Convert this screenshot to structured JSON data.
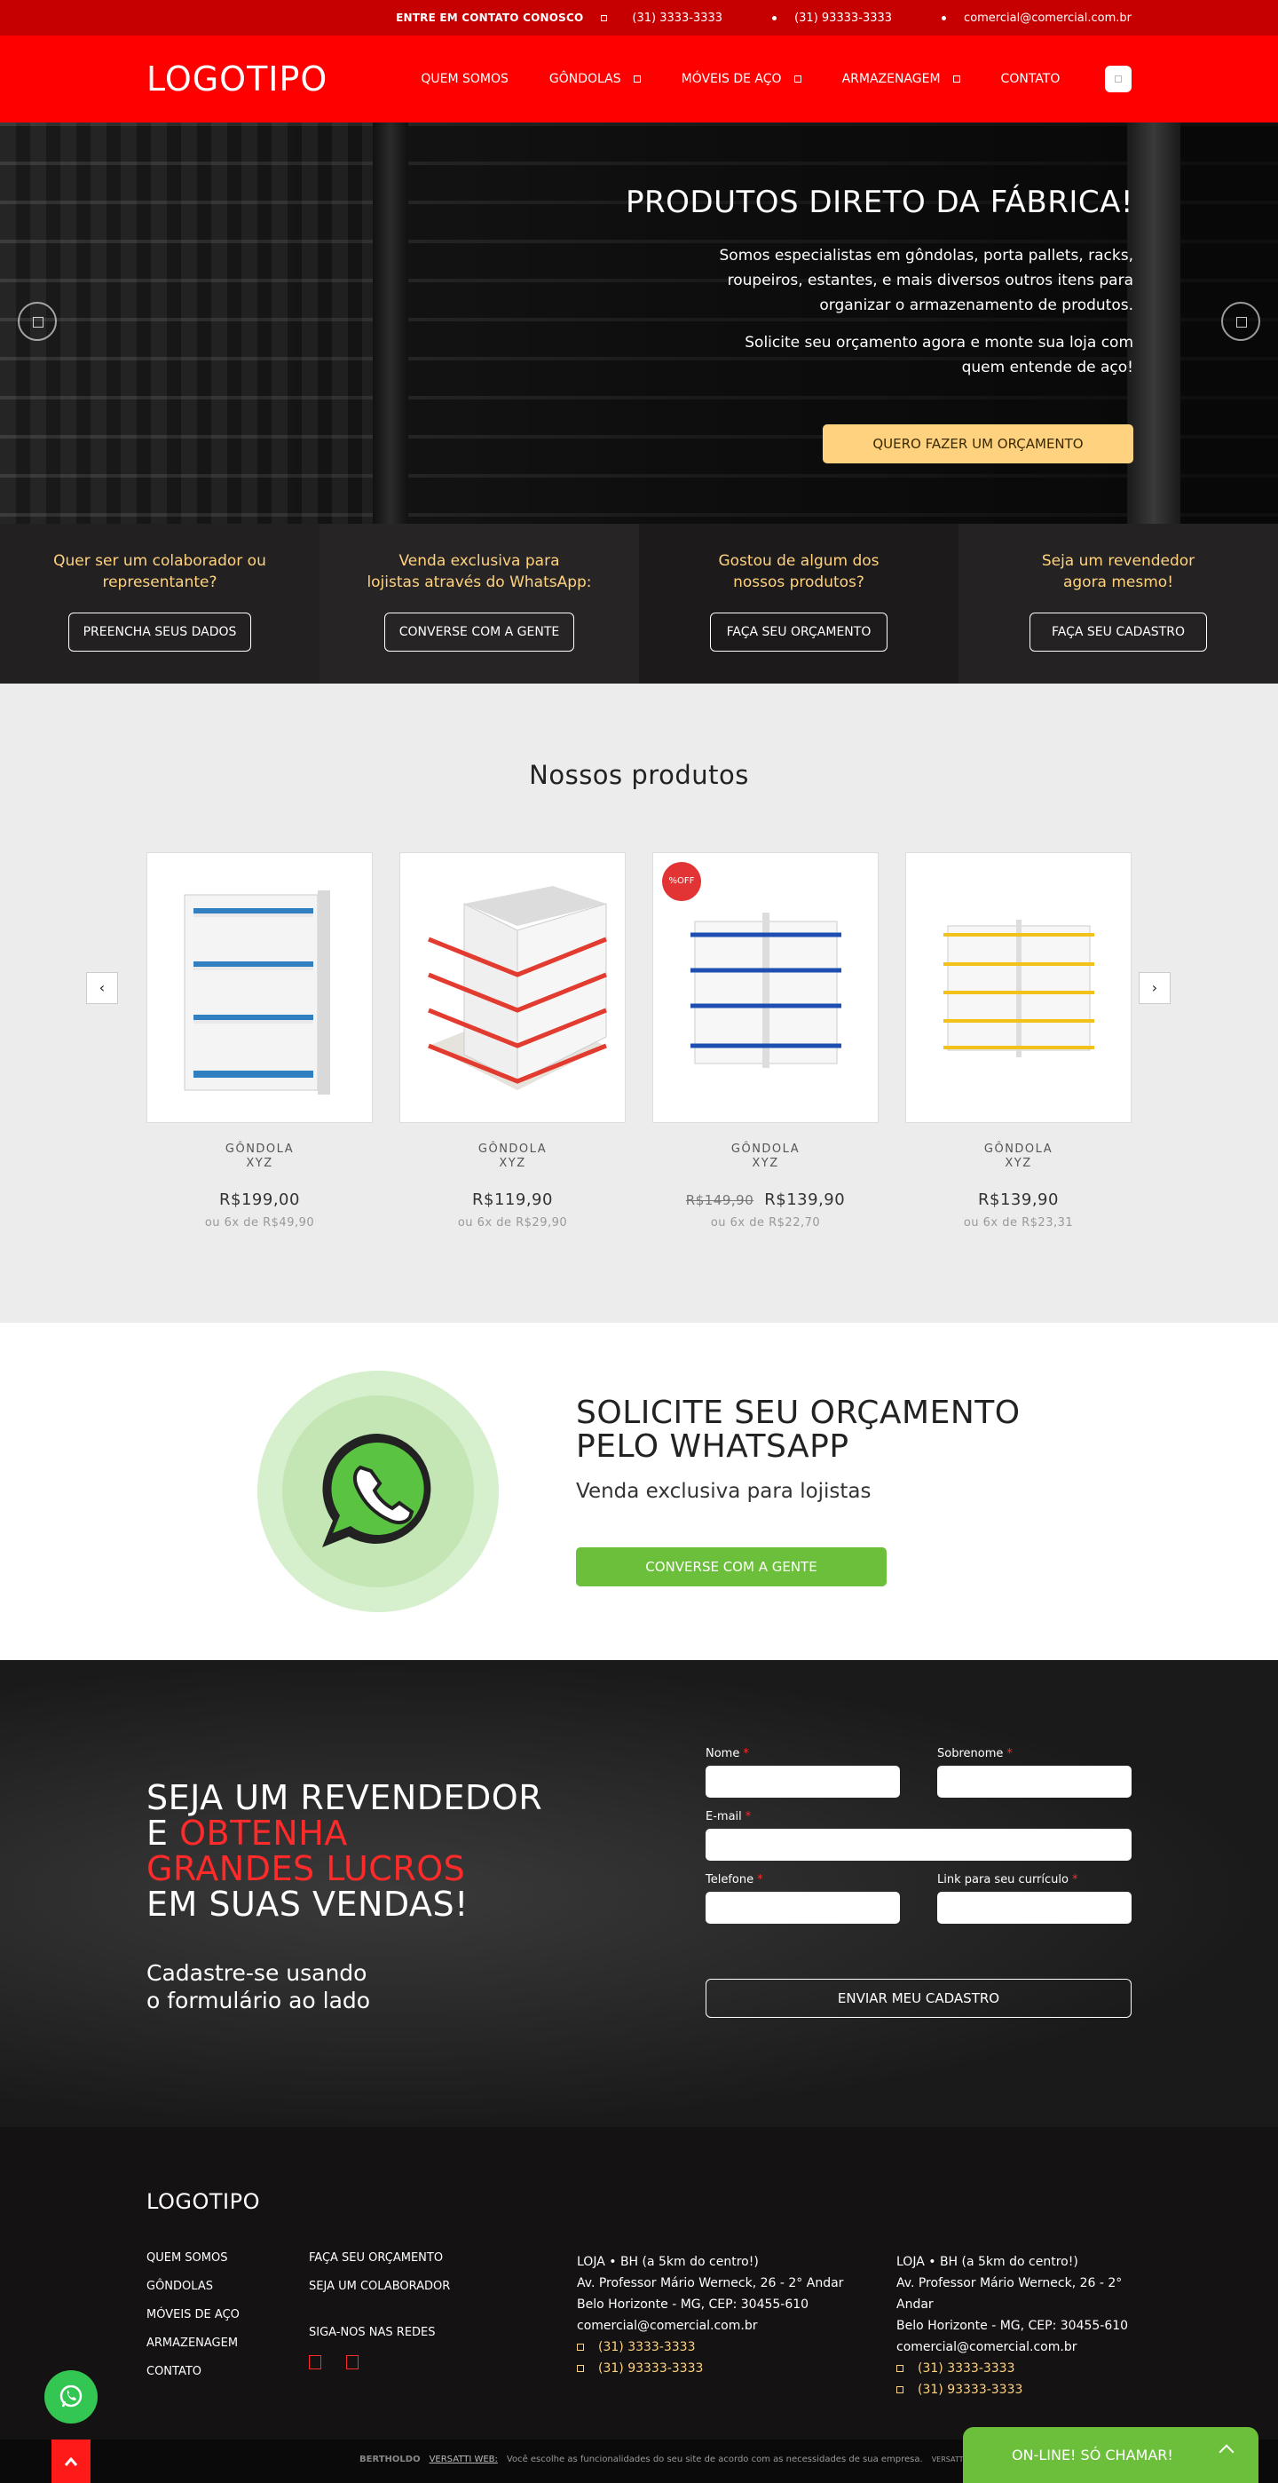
{
  "topbar": {
    "contact_label": "ENTRE EM CONTATO CONOSCO",
    "phone1": "(31) 3333-3333",
    "phone2": "(31) 93333-3333",
    "email": "comercial@comercial.com.br"
  },
  "header": {
    "logo": "LOGOTIPO",
    "nav": [
      "QUEM SOMOS",
      "GÔNDOLAS",
      "MÓVEIS DE AÇO",
      "ARMAZENAGEM",
      "CONTATO"
    ]
  },
  "hero": {
    "title": "PRODUTOS DIRETO DA FÁBRICA!",
    "p1": "Somos especialistas em gôndolas, porta pallets, racks, roupeiros, estantes, e mais diversos outros itens para organizar o armazenamento de produtos.",
    "p2": "Solicite seu orçamento agora e monte sua loja com quem entende de aço!",
    "cta": "QUERO FAZER UM ORÇAMENTO"
  },
  "strip": [
    {
      "text": "Quer ser um colaborador ou\nrepresentante?",
      "button": "PREENCHA SEUS DADOS"
    },
    {
      "text": "Venda exclusiva para\nlojistas através do WhatsApp:",
      "button": "CONVERSE COM A GENTE"
    },
    {
      "text": "Gostou de algum dos\nnossos produtos?",
      "button": "FAÇA SEU ORÇAMENTO"
    },
    {
      "text": "Seja um revendedor\nagora mesmo!",
      "button": "FAÇA SEU CADASTRO"
    }
  ],
  "products": {
    "title": "Nossos produtos",
    "prev": "‹",
    "next": "›",
    "items": [
      {
        "name1": "GÔNDOLA",
        "name2": "XYZ",
        "old_price": "",
        "price": "R$199,00",
        "installments": "ou 6x de R$49,90",
        "badge": "",
        "accent": "#2f7fc1"
      },
      {
        "name1": "GÔNDOLA",
        "name2": "XYZ",
        "old_price": "",
        "price": "R$119,90",
        "installments": "ou 6x de R$29,90",
        "badge": "",
        "accent": "#e23b2f"
      },
      {
        "name1": "GÔNDOLA",
        "name2": "XYZ",
        "old_price": "R$149,90",
        "price": "R$139,90",
        "installments": "ou 6x de R$22,70",
        "badge": "%OFF",
        "accent": "#1d4fb3"
      },
      {
        "name1": "GÔNDOLA",
        "name2": "XYZ",
        "old_price": "",
        "price": "R$139,90",
        "installments": "ou 6x de R$23,31",
        "badge": "",
        "accent": "#f2c21b"
      }
    ]
  },
  "whatsapp": {
    "title": "SOLICITE SEU ORÇAMENTO PELO WHATSAPP",
    "subtitle": "Venda exclusiva para lojistas",
    "button": "CONVERSE COM A GENTE"
  },
  "reseller": {
    "line1": "SEJA UM REVENDEDOR",
    "line2_prefix": "E ",
    "line2_red": "OBTENHA",
    "line3_red": "GRANDES LUCROS",
    "line4": "EM SUAS VENDAS!",
    "sub1": "Cadastre-se usando",
    "sub2": "o formulário ao lado",
    "form": {
      "nome": "Nome",
      "sobrenome": "Sobrenome",
      "email": "E-mail",
      "telefone": "Telefone",
      "curriculo": "Link para seu currículo",
      "required": "*",
      "submit": "ENVIAR MEU CADASTRO"
    }
  },
  "footer": {
    "logo": "LOGOTIPO",
    "col1": [
      "QUEM SOMOS",
      "GÔNDOLAS",
      "MÓVEIS DE AÇO",
      "ARMAZENAGEM",
      "CONTATO"
    ],
    "col2": [
      "FAÇA SEU ORÇAMENTO",
      "SEJA UM COLABORADOR"
    ],
    "social_title": "SIGA-NOS NAS REDES",
    "stores": [
      {
        "title": "LOJA • BH  (a 5km do centro!)",
        "address": "Av. Professor Mário Werneck, 26 - 2° Andar",
        "city": "Belo Horizonte - MG, CEP: 30455-610",
        "email": "comercial@comercial.com.br",
        "phone1": "(31) 3333-3333",
        "phone2": "(31) 93333-3333"
      },
      {
        "title": "LOJA • BH  (a 5km do centro!)",
        "address": "Av. Professor Mário Werneck, 26 - 2° Andar",
        "city": "Belo Horizonte - MG, CEP: 30455-610",
        "email": "comercial@comercial.com.br",
        "phone1": "(31) 3333-3333",
        "phone2": "(31) 93333-3333"
      }
    ]
  },
  "bottom": {
    "brand": "BERTHOLDO",
    "link": "VERSATTI WEB:",
    "text": "Você escolhe as funcionalidades do seu site de acordo com as necessidades de sua empresa.",
    "tag": "VERSATTI WEB",
    "online": "ON-LINE! SÓ CHAMAR!"
  },
  "colors": {
    "brand_red": "#ff0000",
    "topbar_red": "#c60000",
    "accent_yellow": "#ffd27f",
    "whatsapp_green": "#6bbf3a"
  }
}
